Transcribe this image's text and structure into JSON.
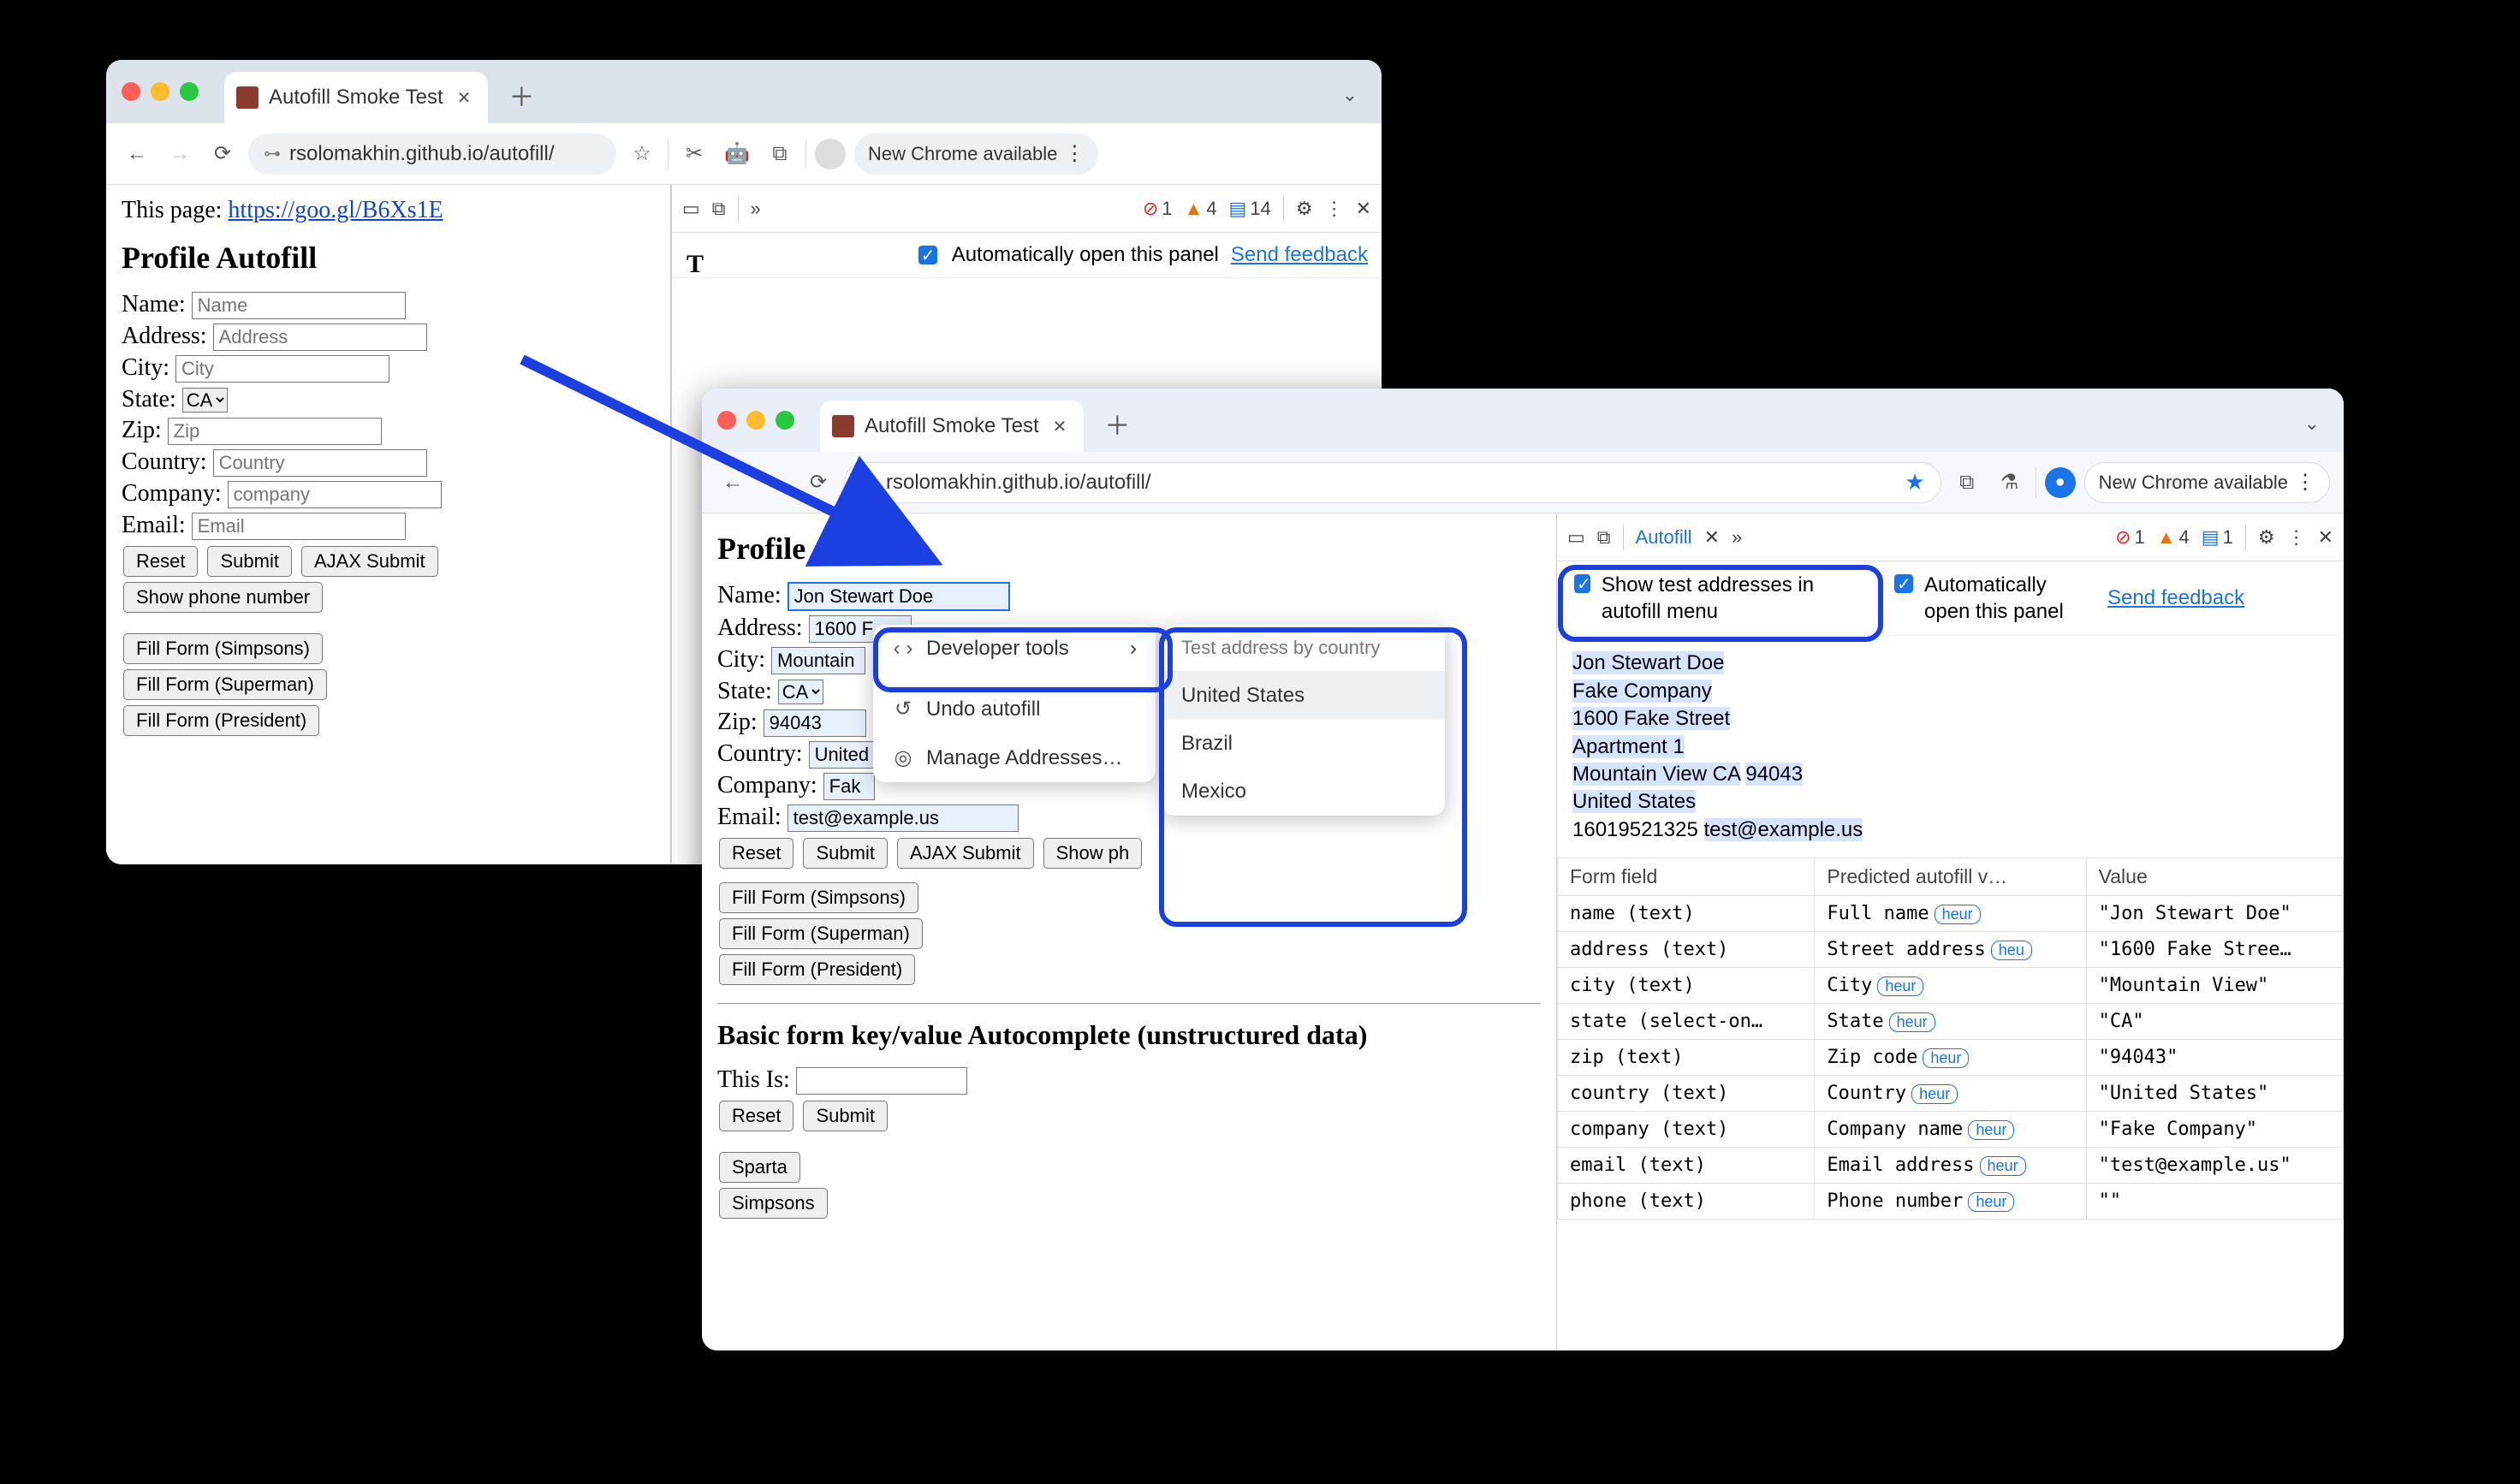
{
  "tab_title": "Autofill Smoke Test",
  "url": "rsolomakhin.github.io/autofill/",
  "new_chrome": "New Chrome available",
  "w1": {
    "thispage_label": "This page: ",
    "thispage_link": "https://goo.gl/B6Xs1E",
    "heading": "Profile Autofill",
    "name_lbl": "Name:",
    "name_ph": "Name",
    "addr_lbl": "Address:",
    "addr_ph": "Address",
    "city_lbl": "City:",
    "city_ph": "City",
    "state_lbl": "State:",
    "state_val": "CA",
    "zip_lbl": "Zip:",
    "zip_ph": "Zip",
    "country_lbl": "Country:",
    "country_ph": "Country",
    "company_lbl": "Company:",
    "company_ph": "company",
    "email_lbl": "Email:",
    "email_ph": "Email",
    "reset": "Reset",
    "submit": "Submit",
    "ajax": "AJAX Submit",
    "showphone": "Show phone number",
    "ff1": "Fill Form (Simpsons)",
    "ff2": "Fill Form (Superman)",
    "ff3": "Fill Form (President)",
    "cutoff_heading": "T",
    "dt_err": "1",
    "dt_warn": "4",
    "dt_msg": "14",
    "auto_open": "Automatically open this panel",
    "feedback": "Send feedback"
  },
  "w2": {
    "heading": "Profile Autofill",
    "name_lbl": "Name:",
    "name_val": "Jon Stewart Doe",
    "addr_lbl": "Address:",
    "addr_val": "1600 F",
    "city_lbl": "City:",
    "city_val": "Mountain",
    "state_lbl": "State:",
    "state_val": "CA",
    "zip_lbl": "Zip:",
    "zip_val": "94043",
    "country_lbl": "Country:",
    "country_val": "United",
    "company_lbl": "Company:",
    "company_val": "Fak",
    "email_lbl": "Email:",
    "email_val": "test@example.us",
    "reset": "Reset",
    "submit": "Submit",
    "ajax": "AJAX Submit",
    "showphone": "Show ph",
    "ff1": "Fill Form (Simpsons)",
    "ff2": "Fill Form (Superman)",
    "ff3": "Fill Form (President)",
    "h2": "Basic form key/value Autocomplete (unstructured data)",
    "thisis": "This Is:",
    "sparta": "Sparta",
    "simpsons": "Simpsons",
    "ctx_dev": "Developer tools",
    "ctx_undo": "Undo autofill",
    "ctx_manage": "Manage Addresses…",
    "sub_title": "Test address by country",
    "sub_us": "United States",
    "sub_br": "Brazil",
    "sub_mx": "Mexico",
    "dt_tab": "Autofill",
    "dt_err": "1",
    "dt_warn": "4",
    "dt_msg": "1",
    "opt_show_test": "Show test addresses in autofill menu",
    "opt_auto": "Automatically open this panel",
    "feedback": "Send feedback",
    "addr": {
      "l1": "Jon Stewart Doe",
      "l2": "Fake Company",
      "l3": "1600 Fake Street",
      "l4": "Apartment 1",
      "l5a": "Mountain View ",
      "l5b": "CA",
      "l5c": " ",
      "l5d": "94043",
      "l6": "United States",
      "l7a": "16019521325",
      "l7b": " ",
      "l7c": "test@example.us"
    },
    "th1": "Form field",
    "th2": "Predicted autofill v…",
    "th3": "Value",
    "rows": [
      {
        "f": "name (text)",
        "p": "Full name",
        "h": "heur",
        "v": "\"Jon Stewart Doe\""
      },
      {
        "f": "address (text)",
        "p": "Street address",
        "h": "heu",
        "v": "\"1600 Fake Stree…"
      },
      {
        "f": "city (text)",
        "p": "City",
        "h": "heur",
        "v": "\"Mountain View\""
      },
      {
        "f": "state (select-on…",
        "p": "State",
        "h": "heur",
        "v": "\"CA\""
      },
      {
        "f": "zip (text)",
        "p": "Zip code",
        "h": "heur",
        "v": "\"94043\""
      },
      {
        "f": "country (text)",
        "p": "Country",
        "h": "heur",
        "v": "\"United States\""
      },
      {
        "f": "company (text)",
        "p": "Company name",
        "h": "heur",
        "v": "\"Fake Company\""
      },
      {
        "f": "email (text)",
        "p": "Email address",
        "h": "heur",
        "v": "\"test@example.us\""
      },
      {
        "f": "phone (text)",
        "p": "Phone number",
        "h": "heur",
        "v": "\"\""
      }
    ]
  }
}
